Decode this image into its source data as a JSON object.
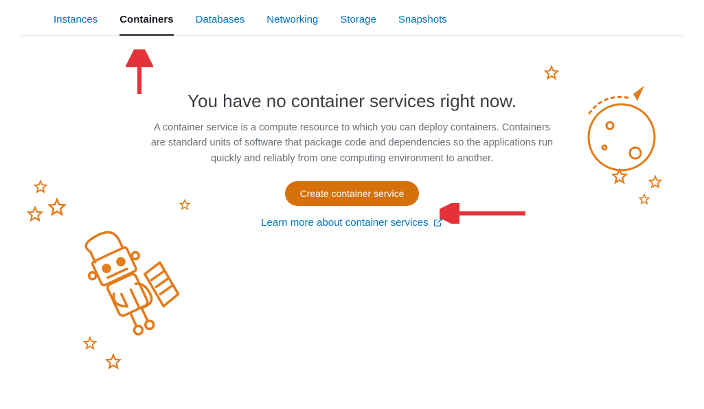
{
  "tabs": {
    "items": [
      {
        "label": "Instances"
      },
      {
        "label": "Containers"
      },
      {
        "label": "Databases"
      },
      {
        "label": "Networking"
      },
      {
        "label": "Storage"
      },
      {
        "label": "Snapshots"
      }
    ],
    "active_index": 1
  },
  "empty_state": {
    "heading": "You have no container services right now.",
    "description": "A container service is a compute resource to which you can deploy containers. Containers are standard units of software that package code and dependencies so the applications run quickly and reliably from one computing environment to another.",
    "create_label": "Create container service",
    "learn_more_label": "Learn more about container services"
  },
  "colors": {
    "link": "#0073bb",
    "accent": "#d5700b",
    "illustration": "#e37b1a",
    "annotation": "#e53238"
  }
}
